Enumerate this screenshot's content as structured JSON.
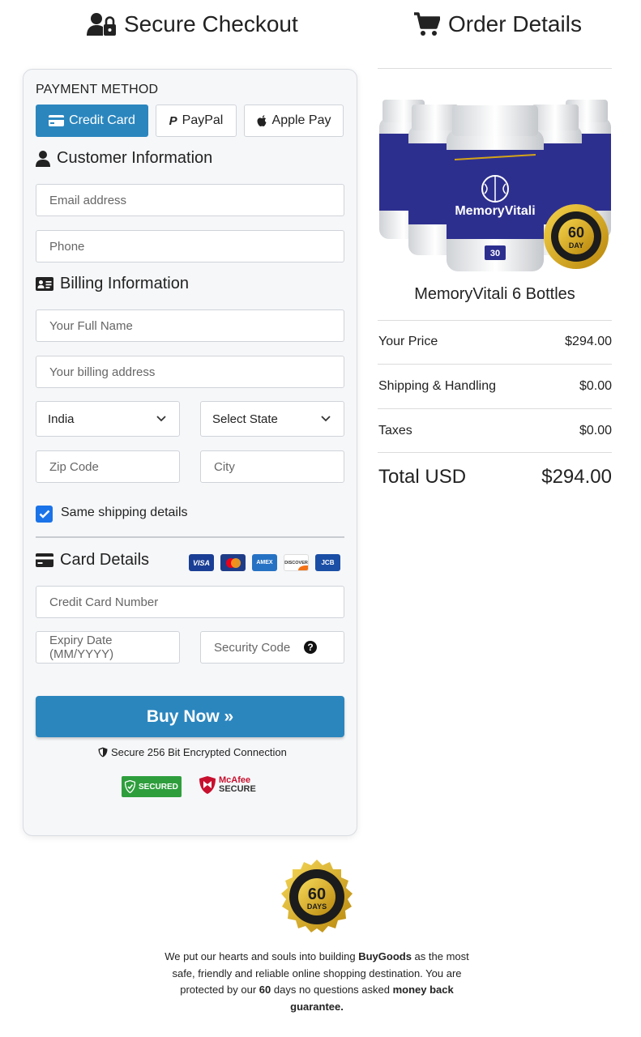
{
  "checkout": {
    "heading": "Secure Checkout",
    "payment_method_label": "PAYMENT METHOD",
    "payment_options": [
      {
        "label": "Credit Card",
        "icon": "credit-card-icon",
        "selected": true
      },
      {
        "label": "PayPal",
        "icon": "paypal-icon",
        "selected": false
      },
      {
        "label": "Apple Pay",
        "icon": "apple-icon",
        "selected": false
      }
    ],
    "customer_info_title": "Customer Information",
    "email_placeholder": "Email address",
    "phone_placeholder": "Phone",
    "billing_info_title": "Billing Information",
    "full_name_placeholder": "Your Full Name",
    "billing_address_placeholder": "Your billing address",
    "country_value": "India",
    "state_value": "Select State",
    "zip_placeholder": "Zip Code",
    "city_placeholder": "City",
    "same_shipping_label": "Same shipping details",
    "same_shipping_checked": true,
    "card_details_title": "Card Details",
    "card_brands": [
      "VISA",
      "Mastercard",
      "AMEX",
      "DISCOVER",
      "JCB"
    ],
    "card_number_placeholder": "Credit Card Number",
    "expiry_placeholder": "Expiry Date (MM/YYYY)",
    "security_code_placeholder": "Security Code",
    "buy_button_label": "Buy Now »",
    "secure_connection_text": "Secure 256 Bit Encrypted Connection",
    "badges": {
      "trustguard": "SECURED",
      "mcafee_line1": "McAfee",
      "mcafee_line2": "SECURE"
    }
  },
  "order": {
    "heading": "Order Details",
    "product_name": "MemoryVitali 6 Bottles",
    "image": {
      "brand": "MemoryVitali",
      "seal_top": "60",
      "seal_bottom": "DAY",
      "bottle_count": "30"
    },
    "rows": [
      {
        "label": "Your Price",
        "value": "$294.00"
      },
      {
        "label": "Shipping & Handling",
        "value": "$0.00"
      },
      {
        "label": "Taxes",
        "value": "$0.00"
      }
    ],
    "total_label": "Total USD",
    "total_value": "$294.00"
  },
  "guarantee": {
    "seal_number": "60",
    "seal_days": "DAYS",
    "text_1": "We put our hearts and souls into building ",
    "brand": "BuyGoods",
    "text_2": " as the most safe, friendly and reliable online shopping destination. You are protected by our ",
    "days": "60",
    "text_3": " days no questions asked ",
    "text_4": "money back guarantee."
  },
  "colors": {
    "accent": "#2b86be",
    "checkbox": "#1a73e8",
    "panel_bg": "#f6f7f9",
    "bottle_blue": "#2d2f8f",
    "gold": "#d4a418"
  }
}
